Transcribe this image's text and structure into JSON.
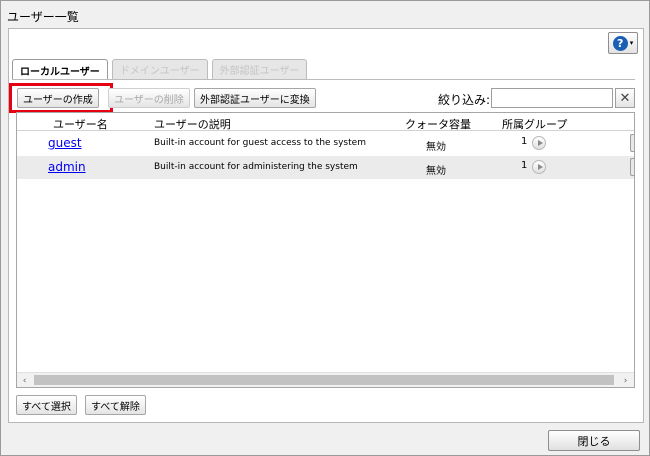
{
  "window": {
    "title": "ユーザー一覧"
  },
  "help": {
    "icon": "question-icon",
    "symbol": "?",
    "caret": "▾"
  },
  "tabs": [
    {
      "label": "ローカルユーザー",
      "active": true
    },
    {
      "label": "ドメインユーザー",
      "active": false
    },
    {
      "label": "外部認証ユーザー",
      "active": false
    }
  ],
  "toolbar": {
    "create_user": "ユーザーの作成",
    "delete_user": "ユーザーの削除",
    "convert_external": "外部認証ユーザーに変換",
    "filter_label": "絞り込み:",
    "filter_value": "",
    "clear_symbol": "✕"
  },
  "table": {
    "columns": [
      "ユーザー名",
      "ユーザーの説明",
      "クォータ容量",
      "所属グループ"
    ],
    "rows": [
      {
        "name": "guest",
        "description": "Built-in account for guest access to the system",
        "quota": "無効",
        "groups": "1"
      },
      {
        "name": "admin",
        "description": "Built-in account for administering the system",
        "quota": "無効",
        "groups": "1"
      }
    ],
    "scroll_left": "‹",
    "scroll_right": "›"
  },
  "footer": {
    "select_all": "すべて選択",
    "deselect_all": "すべて解除",
    "close": "閉じる"
  },
  "colors": {
    "highlight": "#e60012",
    "link": "#0000ee",
    "help": "#1a5fb4"
  }
}
